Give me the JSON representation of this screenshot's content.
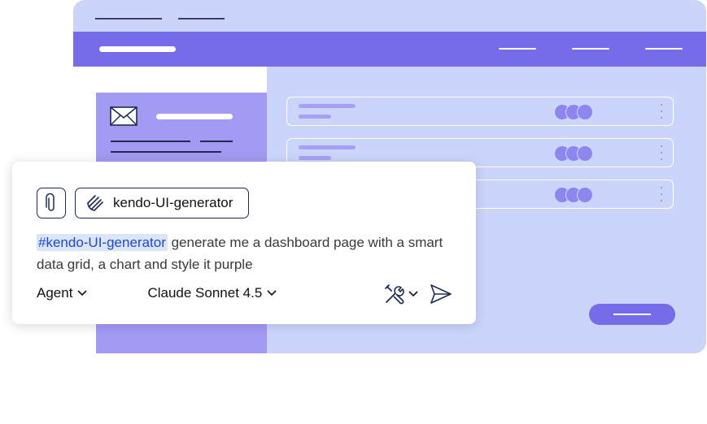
{
  "chat": {
    "context_chip_label": "kendo-UI-generator",
    "mention": "#kendo-UI-generator",
    "prompt_text": " generate me a dashboard page with a smart data grid, a chart and style it purple",
    "mode_label": "Agent",
    "model_label": "Claude Sonnet 4.5"
  },
  "icons": {
    "attach": "paperclip-icon",
    "generator": "generator-icon",
    "tools": "tools-icon",
    "send": "send-icon",
    "mail": "mail-icon"
  },
  "colors": {
    "app_bg": "#cbd5f9",
    "app_bar": "#766be8",
    "side_panel": "#a29af3",
    "mention_bg": "#dbe5fa",
    "mention_text": "#1f49c9"
  }
}
